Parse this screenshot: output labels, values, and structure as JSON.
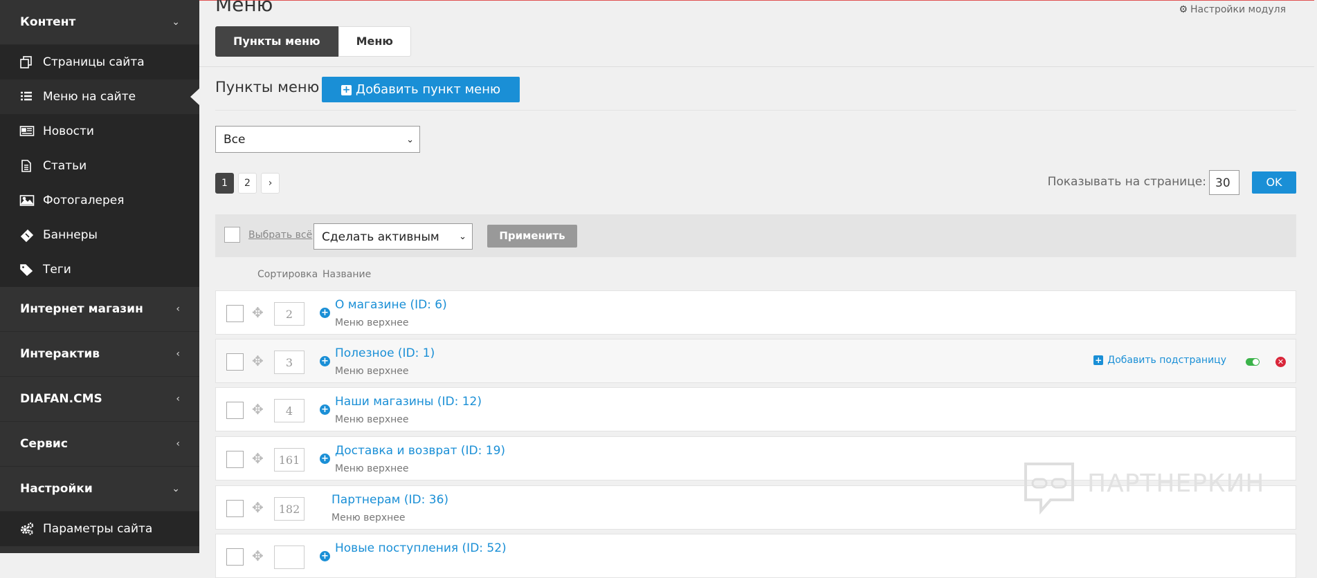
{
  "sidebar": {
    "groups": {
      "content": {
        "label": "Контент",
        "chevron": "chevron-down-icon"
      },
      "shop": {
        "label": "Интернет магазин",
        "chevron": "chevron-left-icon"
      },
      "interactive": {
        "label": "Интерактив",
        "chevron": "chevron-left-icon"
      },
      "cms": {
        "label": "DIAFAN.CMS",
        "chevron": "chevron-left-icon"
      },
      "service": {
        "label": "Сервис",
        "chevron": "chevron-left-icon"
      },
      "settings": {
        "label": "Настройки",
        "chevron": "chevron-down-icon"
      }
    },
    "content_items": [
      {
        "label": "Страницы сайта",
        "icon": "pages-icon"
      },
      {
        "label": "Меню на сайте",
        "icon": "list-icon",
        "active": true
      },
      {
        "label": "Новости",
        "icon": "newspaper-icon"
      },
      {
        "label": "Статьи",
        "icon": "document-icon"
      },
      {
        "label": "Фотогалерея",
        "icon": "image-icon"
      },
      {
        "label": "Баннеры",
        "icon": "ticket-icon"
      },
      {
        "label": "Теги",
        "icon": "tags-icon"
      }
    ],
    "settings_items": [
      {
        "label": "Параметры сайта",
        "icon": "gears-icon"
      }
    ]
  },
  "header": {
    "title": "Меню",
    "module_settings": "Настройки модуля",
    "tabs": [
      {
        "label": "Пункты меню",
        "active": true
      },
      {
        "label": "Меню",
        "active": false
      }
    ]
  },
  "section": {
    "title": "Пункты меню",
    "add_button": "Добавить пункт меню",
    "filter_value": "Все"
  },
  "pagination": {
    "pages": [
      "1",
      "2",
      "›"
    ],
    "current": "1",
    "per_page_label": "Показывать на странице:",
    "per_page_value": "30",
    "ok": "OK"
  },
  "bulk": {
    "select_all": "Выбрать всё",
    "action_value": "Сделать активным",
    "apply": "Применить"
  },
  "columns": {
    "sort": "Сортировка",
    "name": "Название"
  },
  "rows": [
    {
      "sort": "2",
      "title": "О магазине (ID: 6)",
      "menu": "Меню верхнее",
      "expandable": true
    },
    {
      "sort": "3",
      "title": "Полезное (ID: 1)",
      "menu": "Меню верхнее",
      "expandable": true,
      "hover": true,
      "add_subpage": "Добавить подстраницу"
    },
    {
      "sort": "4",
      "title": "Наши магазины (ID: 12)",
      "menu": "Меню верхнее",
      "expandable": true
    },
    {
      "sort": "161",
      "title": "Доставка и возврат (ID: 19)",
      "menu": "Меню верхнее",
      "expandable": true
    },
    {
      "sort": "182",
      "title": "Партнерам (ID: 36)",
      "menu": "Меню верхнее",
      "expandable": false
    },
    {
      "sort": "",
      "title": "Новые поступления (ID: 52)",
      "menu": "",
      "expandable": true
    }
  ],
  "watermark": "ПАРТНЕРКИН",
  "colors": {
    "accent": "#1a8fd6",
    "sidebar": "#333333",
    "danger": "#d9263a",
    "success": "#3bb34a"
  }
}
